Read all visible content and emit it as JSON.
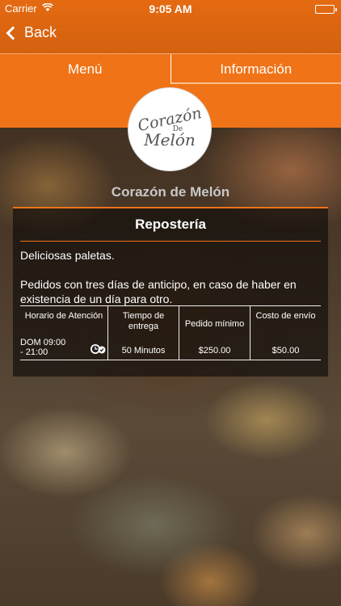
{
  "status_bar": {
    "carrier": "Carrier",
    "time": "9:05 AM"
  },
  "nav": {
    "back_label": "Back"
  },
  "tabs": [
    {
      "label": "Menú"
    },
    {
      "label": "Información"
    }
  ],
  "logo": {
    "line1": "Corazón",
    "line2": "De",
    "line3": "Melón"
  },
  "restaurant": {
    "name": "Corazón de Melón"
  },
  "card": {
    "title": "Repostería",
    "paragraph1": "Deliciosas paletas.",
    "paragraph2": "Pedidos con tres días de anticipo, en caso de haber en existencia de un día para otro."
  },
  "info": {
    "hours_header": "Horario de Atención",
    "hours_value": "DOM 09:00 - 21:00",
    "delivery_time_header": "Tiempo de entrega",
    "delivery_time_value": "50 Minutos",
    "min_order_header": "Pedido mínimo",
    "min_order_value": "$250.00",
    "shipping_header": "Costo de envío",
    "shipping_value": "$50.00"
  },
  "colors": {
    "accent": "#f07317",
    "header": "#e56a12"
  }
}
